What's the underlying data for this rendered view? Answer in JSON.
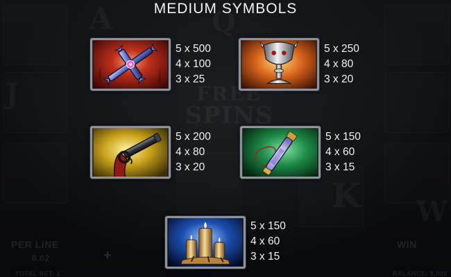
{
  "title": "MEDIUM SYMBOLS",
  "background": {
    "free_spins_line1": "FREE",
    "free_spins_line2": "SPINS",
    "per_line_label": "PER LINE",
    "per_line_value": "0.02",
    "total_bet_label": "TOTAL BET: 1",
    "win_label": "WIN",
    "balance_label": "BALANCE: 5,000"
  },
  "symbols": [
    {
      "icon": "cross-icon",
      "pays": [
        "5 x 500",
        "4 x 100",
        "3 x 25"
      ],
      "frame_color": "#b8281e"
    },
    {
      "icon": "goblet-icon",
      "pays": [
        "5 x 250",
        "4 x 80",
        "3 x 20"
      ],
      "frame_color": "#d86a14"
    },
    {
      "icon": "pistol-icon",
      "pays": [
        "5 x 200",
        "4 x 80",
        "3 x 20"
      ],
      "frame_color": "#c9a31c"
    },
    {
      "icon": "vial-icon",
      "pays": [
        "5 x 150",
        "4 x 60",
        "3 x 15"
      ],
      "frame_color": "#1e8a48"
    },
    {
      "icon": "candles-icon",
      "pays": [
        "5 x 150",
        "4 x 60",
        "3 x 15"
      ],
      "frame_color": "#1c4fb0"
    }
  ],
  "colors": {
    "text": "#f2f2f2",
    "frame_border": "#8e939a",
    "background": "#0b0c0e"
  }
}
